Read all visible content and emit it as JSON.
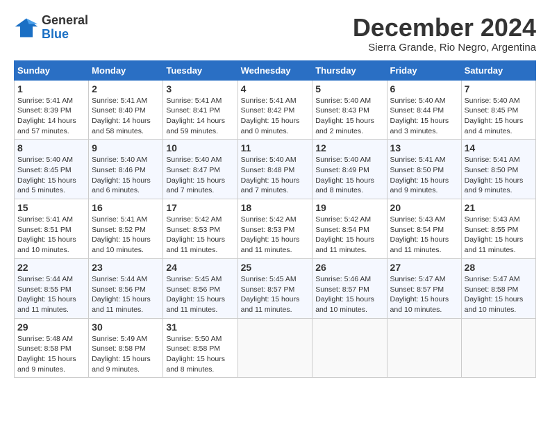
{
  "header": {
    "logo_general": "General",
    "logo_blue": "Blue",
    "month_title": "December 2024",
    "subtitle": "Sierra Grande, Rio Negro, Argentina"
  },
  "days_of_week": [
    "Sunday",
    "Monday",
    "Tuesday",
    "Wednesday",
    "Thursday",
    "Friday",
    "Saturday"
  ],
  "weeks": [
    [
      {
        "day": "1",
        "info": "Sunrise: 5:41 AM\nSunset: 8:39 PM\nDaylight: 14 hours\nand 57 minutes."
      },
      {
        "day": "2",
        "info": "Sunrise: 5:41 AM\nSunset: 8:40 PM\nDaylight: 14 hours\nand 58 minutes."
      },
      {
        "day": "3",
        "info": "Sunrise: 5:41 AM\nSunset: 8:41 PM\nDaylight: 14 hours\nand 59 minutes."
      },
      {
        "day": "4",
        "info": "Sunrise: 5:41 AM\nSunset: 8:42 PM\nDaylight: 15 hours\nand 0 minutes."
      },
      {
        "day": "5",
        "info": "Sunrise: 5:40 AM\nSunset: 8:43 PM\nDaylight: 15 hours\nand 2 minutes."
      },
      {
        "day": "6",
        "info": "Sunrise: 5:40 AM\nSunset: 8:44 PM\nDaylight: 15 hours\nand 3 minutes."
      },
      {
        "day": "7",
        "info": "Sunrise: 5:40 AM\nSunset: 8:45 PM\nDaylight: 15 hours\nand 4 minutes."
      }
    ],
    [
      {
        "day": "8",
        "info": "Sunrise: 5:40 AM\nSunset: 8:45 PM\nDaylight: 15 hours\nand 5 minutes."
      },
      {
        "day": "9",
        "info": "Sunrise: 5:40 AM\nSunset: 8:46 PM\nDaylight: 15 hours\nand 6 minutes."
      },
      {
        "day": "10",
        "info": "Sunrise: 5:40 AM\nSunset: 8:47 PM\nDaylight: 15 hours\nand 7 minutes."
      },
      {
        "day": "11",
        "info": "Sunrise: 5:40 AM\nSunset: 8:48 PM\nDaylight: 15 hours\nand 7 minutes."
      },
      {
        "day": "12",
        "info": "Sunrise: 5:40 AM\nSunset: 8:49 PM\nDaylight: 15 hours\nand 8 minutes."
      },
      {
        "day": "13",
        "info": "Sunrise: 5:41 AM\nSunset: 8:50 PM\nDaylight: 15 hours\nand 9 minutes."
      },
      {
        "day": "14",
        "info": "Sunrise: 5:41 AM\nSunset: 8:50 PM\nDaylight: 15 hours\nand 9 minutes."
      }
    ],
    [
      {
        "day": "15",
        "info": "Sunrise: 5:41 AM\nSunset: 8:51 PM\nDaylight: 15 hours\nand 10 minutes."
      },
      {
        "day": "16",
        "info": "Sunrise: 5:41 AM\nSunset: 8:52 PM\nDaylight: 15 hours\nand 10 minutes."
      },
      {
        "day": "17",
        "info": "Sunrise: 5:42 AM\nSunset: 8:53 PM\nDaylight: 15 hours\nand 11 minutes."
      },
      {
        "day": "18",
        "info": "Sunrise: 5:42 AM\nSunset: 8:53 PM\nDaylight: 15 hours\nand 11 minutes."
      },
      {
        "day": "19",
        "info": "Sunrise: 5:42 AM\nSunset: 8:54 PM\nDaylight: 15 hours\nand 11 minutes."
      },
      {
        "day": "20",
        "info": "Sunrise: 5:43 AM\nSunset: 8:54 PM\nDaylight: 15 hours\nand 11 minutes."
      },
      {
        "day": "21",
        "info": "Sunrise: 5:43 AM\nSunset: 8:55 PM\nDaylight: 15 hours\nand 11 minutes."
      }
    ],
    [
      {
        "day": "22",
        "info": "Sunrise: 5:44 AM\nSunset: 8:55 PM\nDaylight: 15 hours\nand 11 minutes."
      },
      {
        "day": "23",
        "info": "Sunrise: 5:44 AM\nSunset: 8:56 PM\nDaylight: 15 hours\nand 11 minutes."
      },
      {
        "day": "24",
        "info": "Sunrise: 5:45 AM\nSunset: 8:56 PM\nDaylight: 15 hours\nand 11 minutes."
      },
      {
        "day": "25",
        "info": "Sunrise: 5:45 AM\nSunset: 8:57 PM\nDaylight: 15 hours\nand 11 minutes."
      },
      {
        "day": "26",
        "info": "Sunrise: 5:46 AM\nSunset: 8:57 PM\nDaylight: 15 hours\nand 10 minutes."
      },
      {
        "day": "27",
        "info": "Sunrise: 5:47 AM\nSunset: 8:57 PM\nDaylight: 15 hours\nand 10 minutes."
      },
      {
        "day": "28",
        "info": "Sunrise: 5:47 AM\nSunset: 8:58 PM\nDaylight: 15 hours\nand 10 minutes."
      }
    ],
    [
      {
        "day": "29",
        "info": "Sunrise: 5:48 AM\nSunset: 8:58 PM\nDaylight: 15 hours\nand 9 minutes."
      },
      {
        "day": "30",
        "info": "Sunrise: 5:49 AM\nSunset: 8:58 PM\nDaylight: 15 hours\nand 9 minutes."
      },
      {
        "day": "31",
        "info": "Sunrise: 5:50 AM\nSunset: 8:58 PM\nDaylight: 15 hours\nand 8 minutes."
      },
      null,
      null,
      null,
      null
    ]
  ]
}
